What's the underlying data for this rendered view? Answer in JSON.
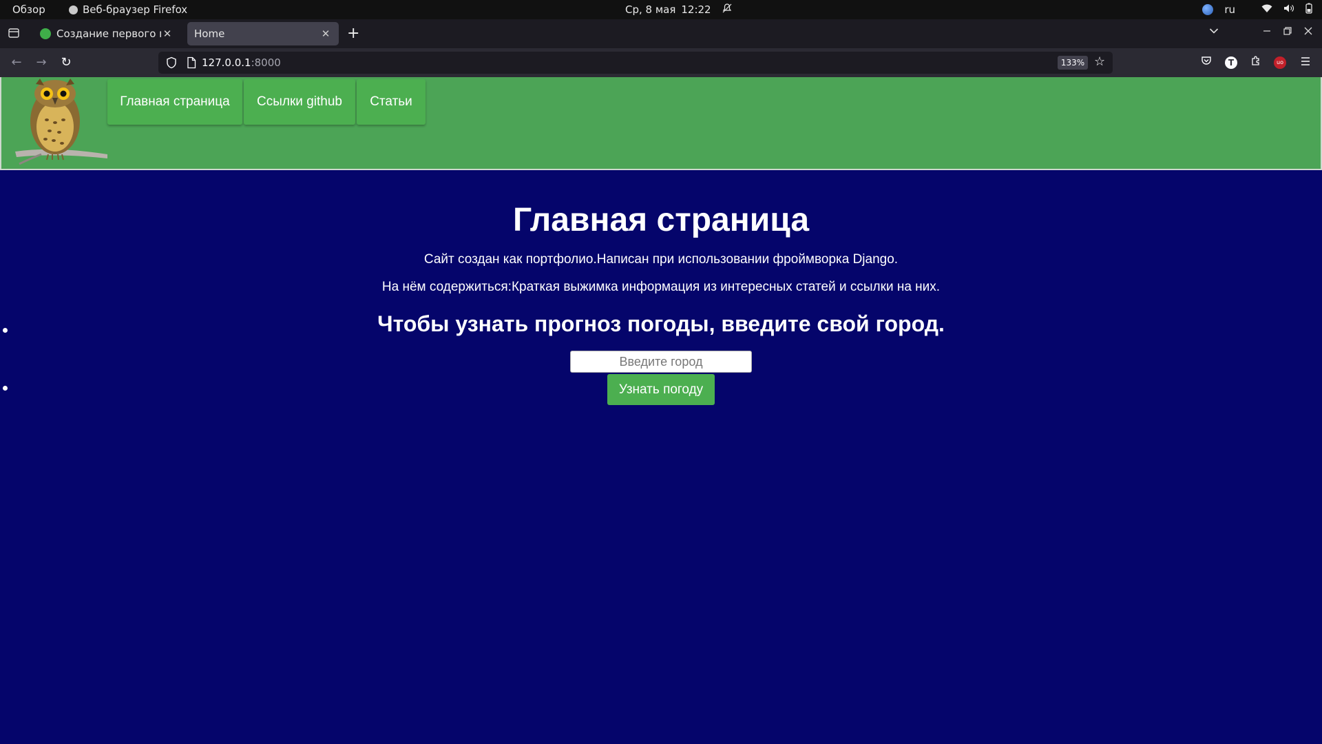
{
  "system_bar": {
    "activities": "Обзор",
    "app_name": "Веб-браузер Firefox",
    "date": "Ср, 8 мая",
    "time": "12:22",
    "language": "ru"
  },
  "browser": {
    "tabs": [
      {
        "title": "Создание первого прил",
        "active": false
      },
      {
        "title": "Home",
        "active": true
      }
    ],
    "url_host": "127.0.0.1",
    "url_port": ":8000",
    "zoom": "133%"
  },
  "site": {
    "nav": [
      {
        "label": "Главная страница"
      },
      {
        "label": "Ссылки github"
      },
      {
        "label": "Статьи"
      }
    ],
    "title": "Главная страница",
    "intro_1": "Сайт создан как портфолио.Написан при использовании фроймворка Django.",
    "intro_2": "На нём содержиться:Краткая выжимка информация из интересных статей и ссылки на них.",
    "weather_heading": "Чтобы узнать прогноз погоды, введите свой город.",
    "city_placeholder": "Введите город",
    "submit_label": "Узнать погоду"
  },
  "colors": {
    "page_background": "#05056b",
    "header_background": "#4ca456",
    "button_green": "#4caf50"
  }
}
